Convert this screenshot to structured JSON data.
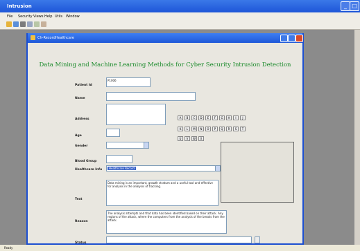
{
  "app": {
    "title": "Intrusion",
    "menus": [
      "File",
      "Security",
      "Views",
      "Help",
      "Utils",
      "Window"
    ],
    "status": "Ready"
  },
  "child": {
    "title": "Ch-RecordHealthcare",
    "heading": "Data Mining and Machine Learning Methods for Cyber Security Intrusion Detection"
  },
  "form": {
    "patient_id_label": "Patient Id",
    "patient_id_value": "P1006",
    "name_label": "Name",
    "address_label": "Address",
    "age_label": "Age",
    "gender_label": "Gender",
    "blood_group_label": "Blood Group",
    "healthcare_label": "Healthcare Info",
    "healthcare_value": "Healthcare Record",
    "text_label": "Text",
    "text_value": "Data mining is an important, growth stratum and a useful tool and effective for analysis in the analysis of tracking.",
    "reason_label": "Reason",
    "reason_value": "The analysis attempts and that data has been identified based on their attack. Any regions of the attack, where the computers from the analysis of the breaks from the attack.",
    "bottom_label": "Status"
  },
  "keyboard": {
    "row1": [
      "A",
      "B",
      "C",
      "D",
      "E",
      "F",
      "G",
      "H",
      "I",
      "J"
    ],
    "row2": [
      "K",
      "L",
      "M",
      "N",
      "O",
      "P",
      "Q",
      "R",
      "S",
      "T"
    ],
    "row3": [
      "U",
      "V",
      "W",
      "X"
    ]
  }
}
